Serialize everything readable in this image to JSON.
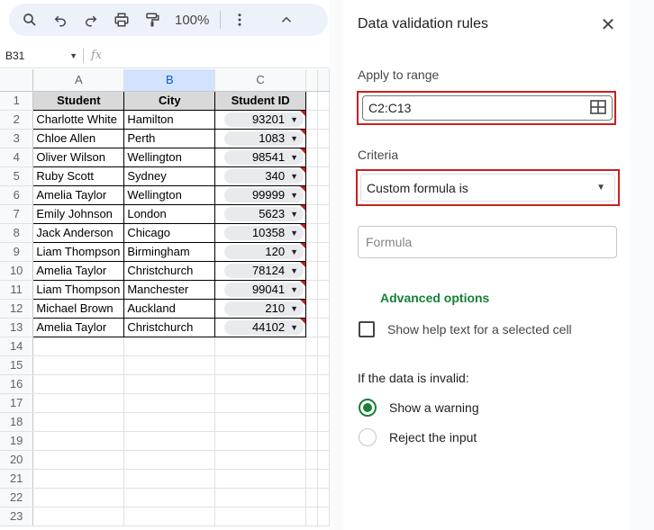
{
  "toolbar": {
    "zoom": "100%",
    "icons": [
      "search-icon",
      "undo-icon",
      "redo-icon",
      "print-icon",
      "paint-format-icon",
      "more-vert-icon",
      "collapse-icon"
    ]
  },
  "formula_bar": {
    "name_box": "B31",
    "fx": "fx"
  },
  "columns": [
    "A",
    "B",
    "C"
  ],
  "rows": [
    "1",
    "2",
    "3",
    "4",
    "5",
    "6",
    "7",
    "8",
    "9",
    "10",
    "11",
    "12",
    "13",
    "14",
    "15",
    "16",
    "17",
    "18",
    "19",
    "20",
    "21",
    "22",
    "23"
  ],
  "table": {
    "headers": [
      "Student",
      "City",
      "Student ID"
    ],
    "data": [
      [
        "Charlotte White",
        "Hamilton",
        "93201"
      ],
      [
        "Chloe Allen",
        "Perth",
        "1083"
      ],
      [
        "Oliver Wilson",
        "Wellington",
        "98541"
      ],
      [
        "Ruby Scott",
        "Sydney",
        "340"
      ],
      [
        "Amelia Taylor",
        "Wellington",
        "99999"
      ],
      [
        "Emily Johnson",
        "London",
        "5623"
      ],
      [
        "Jack Anderson",
        "Chicago",
        "10358"
      ],
      [
        "Liam Thompson",
        "Birmingham",
        "120"
      ],
      [
        "Amelia Taylor",
        "Christchurch",
        "78124"
      ],
      [
        "Liam Thompson",
        "Manchester",
        "99041"
      ],
      [
        "Michael Brown",
        "Auckland",
        "210"
      ],
      [
        "Amelia Taylor",
        "Christchurch",
        "44102"
      ]
    ]
  },
  "panel": {
    "title": "Data validation rules",
    "apply_label": "Apply to range",
    "range_value": "C2:C13",
    "criteria_label": "Criteria",
    "criteria_value": "Custom formula is",
    "formula_placeholder": "Formula",
    "advanced_options": "Advanced options",
    "help_text_label": "Show help text for a selected cell",
    "invalid_label": "If the data is invalid:",
    "option_warning": "Show a warning",
    "option_reject": "Reject the input"
  },
  "colors": {
    "accent_green": "#188038",
    "highlight_red": "#c5221f",
    "selected_col": "#d3e3fd"
  }
}
